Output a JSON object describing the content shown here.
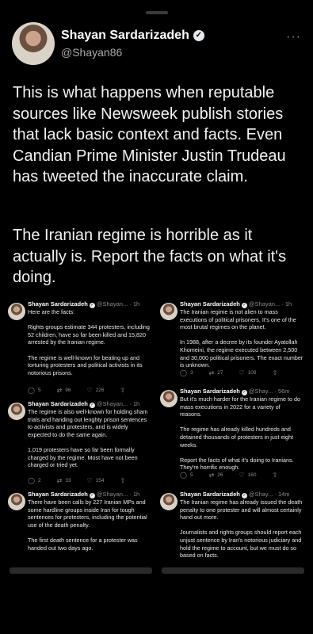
{
  "author": {
    "name": "Shayan Sardarizadeh",
    "handle": "@Shayan86",
    "more": "···"
  },
  "tweet": {
    "para1": "This is what happens when reputable sources like Newsweek publish stories that lack basic context and facts. Even Candian Prime Minister Justin Trudeau has tweeted the inaccurate claim.",
    "para2": "The Iranian regime is horrible as it actually is. Report the facts on what it's doing."
  },
  "icons": {
    "verified": "verified-badge-icon",
    "reply": "reply-icon",
    "retweet": "retweet-icon",
    "like": "heart-icon",
    "share": "share-icon"
  },
  "embedded": {
    "left": [
      {
        "name": "Shayan Sardarizadeh",
        "handle_time": "@Shayan... · 1h",
        "text": "Here are the facts:\n\nRights groups estimate 344 protesters, including 52 children, have so far been killed and 15,820 arrested by the Iranian regime.\n\nThe regime is well-known for beating up and torturing protesters and political activists in its notorious prisons.",
        "replies": "5",
        "retweets": "96",
        "likes": "226"
      },
      {
        "name": "Shayan Sardarizadeh",
        "handle_time": "@Shayan... · 1h",
        "text": "The regime is also well-known for holding sham trials and handing out lenghty prison sentences to activists and protesters, and is widely expected to do the same again.\n\n1,019 protesters have so far been formally charged by the regime. Most have not been charged or tried yet.",
        "replies": "2",
        "retweets": "33",
        "likes": "154"
      },
      {
        "name": "Shayan Sardarizadeh",
        "handle_time": "@Shayan... · 1h",
        "text": "There have been calls by 227 Iranian MPs and some hardline groups inside Iran for tough sentences for protesters, including the potential use of the death penalty.\n\nThe first death sentence for a protester was handed out two days ago.",
        "replies": "",
        "retweets": "",
        "likes": ""
      }
    ],
    "right": [
      {
        "name": "Shayan Sardarizadeh",
        "handle_time": "@Shayan... · 1h",
        "text": "The Iranian regime is not alien to mass executions of political prisoners. It's one of the most brutal regimes on the planet.\n\nIn 1988, after a decree by its founder Ayatollah Khomeini, the regime executed between 2,500 and 30,000 political prisoners. The exact number is unknown.",
        "replies": "3",
        "retweets": "27",
        "likes": "109"
      },
      {
        "name": "Shayan Sardarizadeh",
        "handle_time": "@Shay... · 56m",
        "text": "But it's much harder for the Iranian regime to do mass executions in 2022 for a variety of reasons.\n\nThe regime has already killed hundreds and detained thousands of protesters in just eight weeks.\n\nReport the facts of what it's doing to Iranians. They're horrific enough.",
        "replies": "5",
        "retweets": "26",
        "likes": "160"
      },
      {
        "name": "Shayan Sardarizadeh",
        "handle_time": "@Shay... · 14m",
        "text": "The Iranian regime has already issued the death penalty to one protester and will almost certainly hand out more.\n\nJournalists and rights groups should report each unjust sentence by Iran's notorious judiciary and hold the regime to account, but we must do so based on facts.",
        "replies": "",
        "retweets": "",
        "likes": ""
      }
    ]
  }
}
